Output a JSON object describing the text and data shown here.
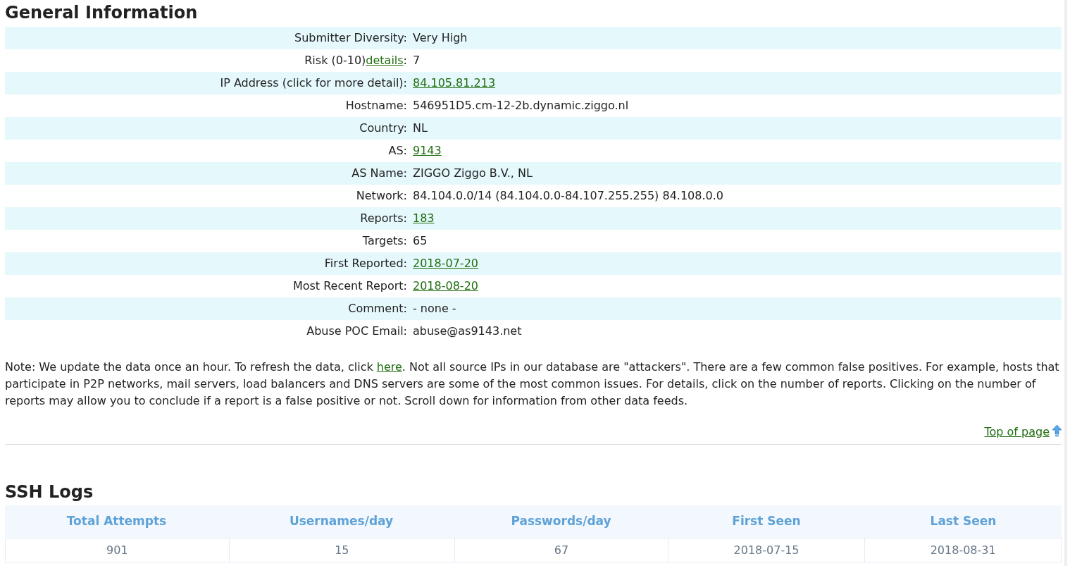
{
  "general": {
    "title": "General Information",
    "rows": [
      {
        "label": "Submitter Diversity:",
        "value": "Very High",
        "link": false
      },
      {
        "label": "Risk (0-10)",
        "label_link": "details",
        "label_end": ":",
        "value": "7",
        "link": false
      },
      {
        "label": "IP Address (click for more detail):",
        "value": "84.105.81.213",
        "link": true
      },
      {
        "label": "Hostname:",
        "value": "546951D5.cm-12-2b.dynamic.ziggo.nl",
        "link": false
      },
      {
        "label": "Country:",
        "value": "NL",
        "link": false
      },
      {
        "label": "AS:",
        "value": "9143",
        "link": true
      },
      {
        "label": "AS Name:",
        "value": "ZIGGO Ziggo B.V., NL",
        "link": false
      },
      {
        "label": "Network:",
        "value": "84.104.0.0/14 (84.104.0.0-84.107.255.255) 84.108.0.0",
        "link": false
      },
      {
        "label": "Reports:",
        "value": "183",
        "link": true
      },
      {
        "label": "Targets:",
        "value": "65",
        "link": false
      },
      {
        "label": "First Reported:",
        "value": "2018-07-20",
        "link": true
      },
      {
        "label": "Most Recent Report:",
        "value": "2018-08-20",
        "link": true
      },
      {
        "label": "Comment:",
        "value": "- none -",
        "link": false
      },
      {
        "label": "Abuse POC Email:",
        "value": "abuse@as9143.net",
        "link": false
      }
    ],
    "note": {
      "before": "Note: We update the data once an hour. To refresh the data, click ",
      "link": "here",
      "after": ". Not all source IPs in our database are \"attackers\". There are a few common false positives. For example, hosts that participate in P2P networks, mail servers, load balancers and DNS servers are some of the most common issues. For details, click on the number of reports. Clicking on the number of reports may allow you to conclude if a report is a false positive or not. Scroll down for information from other data feeds."
    },
    "top_link": "Top of page"
  },
  "ssh_logs": {
    "title": "SSH Logs",
    "columns": [
      "Total Attempts",
      "Usernames/day",
      "Passwords/day",
      "First Seen",
      "Last Seen"
    ],
    "rows": [
      [
        "901",
        "15",
        "67",
        "2018-07-15",
        "2018-08-31"
      ]
    ]
  }
}
